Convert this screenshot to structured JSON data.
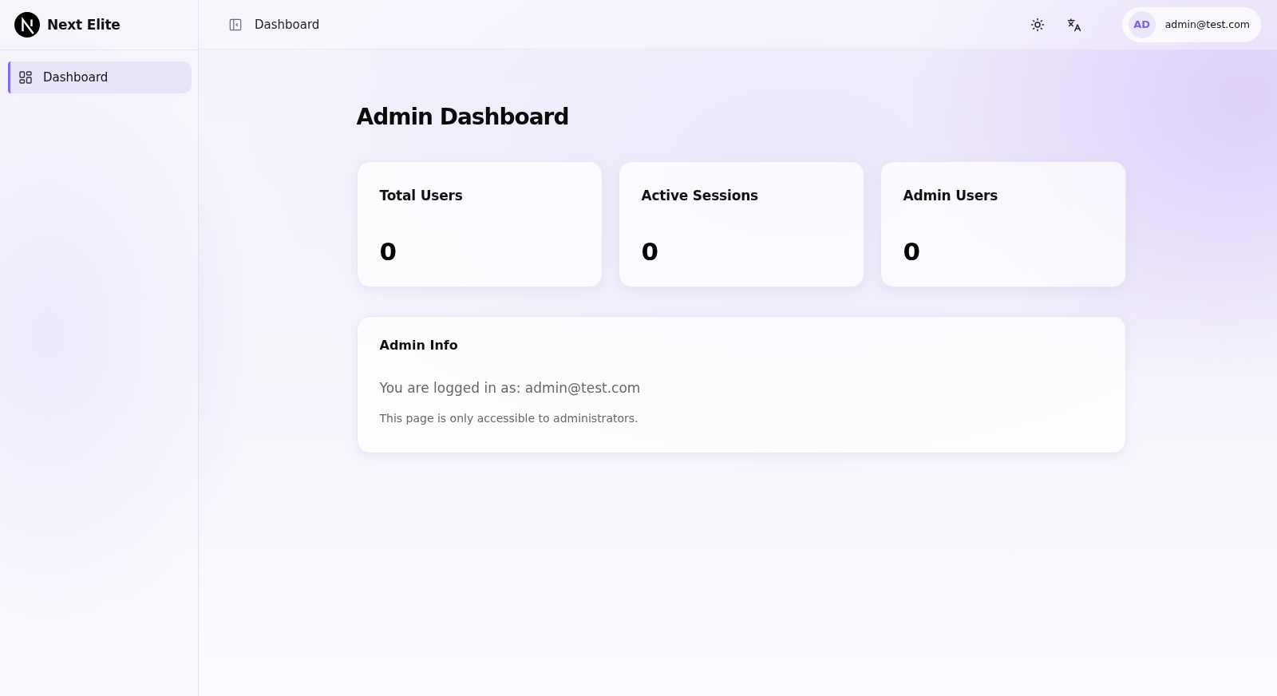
{
  "sidebar": {
    "brand": {
      "name": "Next Elite"
    },
    "items": [
      {
        "label": "Dashboard",
        "selected": true
      }
    ]
  },
  "header": {
    "breadcrumb": "Dashboard",
    "user": {
      "initials": "AD",
      "email": "admin@test.com"
    }
  },
  "page": {
    "title": "Admin Dashboard",
    "stats": [
      {
        "label": "Total Users",
        "value": "0"
      },
      {
        "label": "Active Sessions",
        "value": "0"
      },
      {
        "label": "Admin Users",
        "value": "0"
      }
    ],
    "info": {
      "title": "Admin Info",
      "lines": [
        "You are logged in as: admin@test.com",
        "This page is only accessible to administrators."
      ]
    }
  }
}
